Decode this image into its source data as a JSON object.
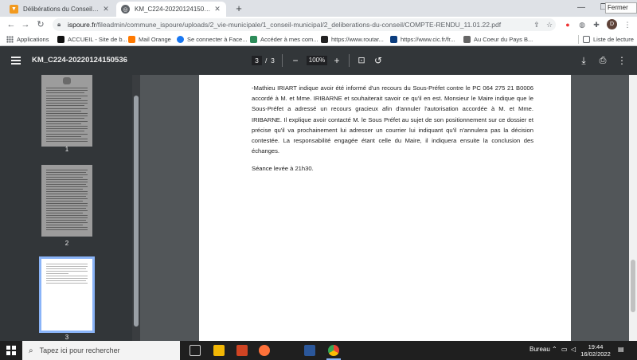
{
  "tabs": [
    {
      "title": "Délibérations du Conseil - Commu",
      "icon": "orange-logo-icon"
    },
    {
      "title": "KM_C224-20220124150536",
      "icon": "globe-icon"
    }
  ],
  "tooltip": "Fermer",
  "address": {
    "url_host": "ispoure.fr",
    "url_path": "/fileadmin/commune_ispoure/uploads/2_vie-municipale/1_conseil-municipal/2_deliberations-du-conseil/COMPTE-RENDU_11.01.22.pdf"
  },
  "profile_initial": "D",
  "bookmarks": {
    "apps": "Applications",
    "items": [
      {
        "label": "ACCUEIL - Site de b...",
        "color": "#111111"
      },
      {
        "label": "Mail Orange",
        "color": "#ff7900"
      },
      {
        "label": "Se connecter à Face...",
        "color": "#1877f2"
      },
      {
        "label": "Accéder à mes com...",
        "color": "#2d8c5a"
      },
      {
        "label": "https://www.routar...",
        "color": "#222222"
      },
      {
        "label": "https://www.cic.fr/fr...",
        "color": "#0b3d7e"
      },
      {
        "label": "Au Coeur du Pays B...",
        "color": "#666666"
      }
    ],
    "reading_list": "Liste de lecture"
  },
  "pdf": {
    "filename": "KM_C224-20220124150536",
    "current_page": "3",
    "page_separator": "/",
    "total_pages": "3",
    "zoom": "100%",
    "thumb_labels": [
      "1",
      "2",
      "3"
    ],
    "paragraph": "-Mathieu IRIART indique avoir été informé d'un recours du Sous-Préfet contre le PC 064 275 21 B0006 accordé à M. et Mme. IRIBARNE et souhaiterait savoir ce qu'il en est. Monsieur le Maire indique que le Sous-Préfet a adressé un recours gracieux afin d'annuler l'autorisation accordée à M. et Mme. IRIBARNE. Il explique avoir contacté M. le Sous Préfet au sujet de son positionnement sur ce dossier et précise qu'il va prochainement lui adresser un courrier lui indiquant qu'il n'annulera pas la décision contestée. La responsabilité engagée étant celle du Maire, il indiquera ensuite la conclusion des échanges.",
    "closing": "Séance levée à 21h30."
  },
  "taskbar": {
    "search_placeholder": "Tapez ici pour rechercher",
    "tray_label": "Bureau",
    "time": "19:44",
    "date": "16/02/2022",
    "apps": [
      {
        "name": "task-view-icon",
        "color": "#cfcfcf"
      },
      {
        "name": "photos-app-icon",
        "color": "#f2b705"
      },
      {
        "name": "powerpoint-icon",
        "color": "#d04423"
      },
      {
        "name": "firefox-icon",
        "color": "#ff7139"
      },
      {
        "name": "word-icon",
        "color": "#2b579a"
      },
      {
        "name": "chrome-icon",
        "color": "#4caf50"
      }
    ]
  }
}
